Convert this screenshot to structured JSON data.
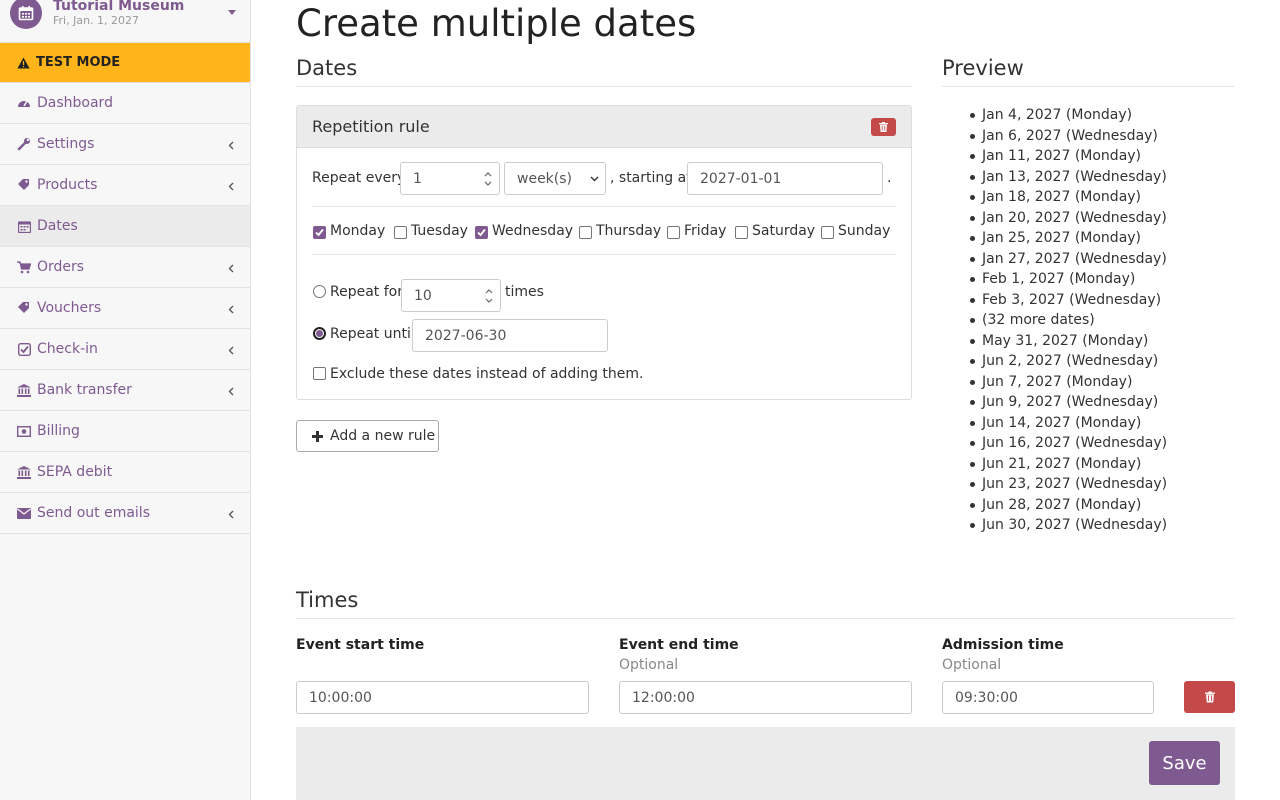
{
  "event": {
    "name": "Tutorial Museum",
    "date": "Fri, Jan. 1, 2027"
  },
  "test_mode": "TEST MODE",
  "nav": [
    {
      "label": "Dashboard",
      "icon": "dashboard-icon",
      "chevron": false
    },
    {
      "label": "Settings",
      "icon": "wrench-icon",
      "chevron": true
    },
    {
      "label": "Products",
      "icon": "tags-icon",
      "chevron": true
    },
    {
      "label": "Dates",
      "icon": "calendar-icon",
      "chevron": false,
      "active": true
    },
    {
      "label": "Orders",
      "icon": "cart-icon",
      "chevron": true
    },
    {
      "label": "Vouchers",
      "icon": "tags-icon",
      "chevron": true
    },
    {
      "label": "Check-in",
      "icon": "check-square-icon",
      "chevron": true
    },
    {
      "label": "Bank transfer",
      "icon": "bank-icon",
      "chevron": true
    },
    {
      "label": "Billing",
      "icon": "money-icon",
      "chevron": false
    },
    {
      "label": "SEPA debit",
      "icon": "bank-icon",
      "chevron": false
    },
    {
      "label": "Send out emails",
      "icon": "envelope-icon",
      "chevron": true
    }
  ],
  "page_title": "Create multiple dates",
  "dates_section": "Dates",
  "rule": {
    "title": "Repetition rule",
    "repeat_every_label": "Repeat every",
    "interval": "1",
    "unit": "week(s)",
    "starting_at_label": ", starting at",
    "start_date": "2027-01-01",
    "period": ".",
    "weekdays": [
      {
        "label": "Monday",
        "checked": true
      },
      {
        "label": "Tuesday",
        "checked": false
      },
      {
        "label": "Wednesday",
        "checked": true
      },
      {
        "label": "Thursday",
        "checked": false
      },
      {
        "label": "Friday",
        "checked": false
      },
      {
        "label": "Saturday",
        "checked": false
      },
      {
        "label": "Sunday",
        "checked": false
      }
    ],
    "repeat_for_label": "Repeat for",
    "repeat_count": "10",
    "times_label": "times",
    "repeat_until_label": "Repeat until",
    "until_date": "2027-06-30",
    "exclude_label": "Exclude these dates instead of adding them."
  },
  "add_rule_label": "Add a new rule",
  "preview_section": "Preview",
  "preview_items": [
    "Jan 4, 2027 (Monday)",
    "Jan 6, 2027 (Wednesday)",
    "Jan 11, 2027 (Monday)",
    "Jan 13, 2027 (Wednesday)",
    "Jan 18, 2027 (Monday)",
    "Jan 20, 2027 (Wednesday)",
    "Jan 25, 2027 (Monday)",
    "Jan 27, 2027 (Wednesday)",
    "Feb 1, 2027 (Monday)",
    "Feb 3, 2027 (Wednesday)",
    "(32 more dates)",
    "May 31, 2027 (Monday)",
    "Jun 2, 2027 (Wednesday)",
    "Jun 7, 2027 (Monday)",
    "Jun 9, 2027 (Wednesday)",
    "Jun 14, 2027 (Monday)",
    "Jun 16, 2027 (Wednesday)",
    "Jun 21, 2027 (Monday)",
    "Jun 23, 2027 (Wednesday)",
    "Jun 28, 2027 (Monday)",
    "Jun 30, 2027 (Wednesday)"
  ],
  "times_section": "Times",
  "times": {
    "start_label": "Event start time",
    "start_value": "10:00:00",
    "end_label": "Event end time",
    "end_sub": "Optional",
    "end_value": "12:00:00",
    "admission_label": "Admission time",
    "admission_sub": "Optional",
    "admission_value": "09:30:00"
  },
  "save_label": "Save",
  "colors": {
    "brand": "#7f5a91",
    "warning": "#ffb419",
    "danger": "#c44a4a"
  }
}
